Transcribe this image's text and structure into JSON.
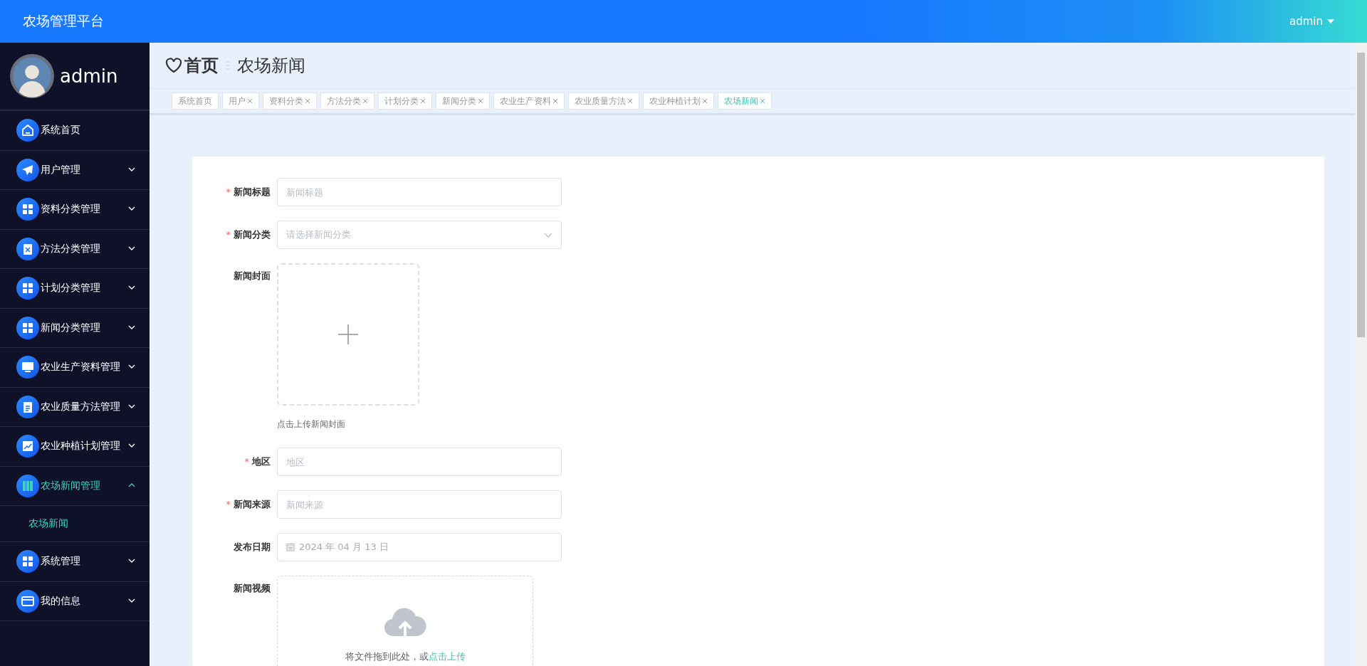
{
  "header": {
    "title": "农场管理平台",
    "user": "admin"
  },
  "profile": {
    "name": "admin"
  },
  "menu": [
    {
      "label": "系统首页",
      "selected": false
    },
    {
      "label": "用户管理",
      "selected": false,
      "expanded": false
    },
    {
      "label": "资料分类管理",
      "selected": false,
      "expanded": false
    },
    {
      "label": "方法分类管理",
      "selected": false,
      "expanded": false
    },
    {
      "label": "计划分类管理",
      "selected": false,
      "expanded": false
    },
    {
      "label": "新闻分类管理",
      "selected": false,
      "expanded": false
    },
    {
      "label": "农业生产资料管理",
      "selected": false,
      "expanded": false
    },
    {
      "label": "农业质量方法管理",
      "selected": false,
      "expanded": false
    },
    {
      "label": "农业种植计划管理",
      "selected": false,
      "expanded": false
    },
    {
      "label": "农场新闻管理",
      "selected": true,
      "expanded": true,
      "children": [
        {
          "label": "农场新闻",
          "selected": true
        }
      ]
    },
    {
      "label": "系统管理",
      "selected": false,
      "expanded": false
    },
    {
      "label": "我的信息",
      "selected": false,
      "expanded": false
    }
  ],
  "breadcrumb": {
    "home": "首页",
    "current": "农场新闻"
  },
  "tags": [
    {
      "label": "系统首页",
      "closable": false,
      "selected": false
    },
    {
      "label": "用户",
      "closable": true,
      "selected": false
    },
    {
      "label": "资料分类",
      "closable": true,
      "selected": false
    },
    {
      "label": "方法分类",
      "closable": true,
      "selected": false
    },
    {
      "label": "计划分类",
      "closable": true,
      "selected": false
    },
    {
      "label": "新闻分类",
      "closable": true,
      "selected": false
    },
    {
      "label": "农业生产资料",
      "closable": true,
      "selected": false
    },
    {
      "label": "农业质量方法",
      "closable": true,
      "selected": false
    },
    {
      "label": "农业种植计划",
      "closable": true,
      "selected": false
    },
    {
      "label": "农场新闻",
      "closable": true,
      "selected": true
    }
  ],
  "form": [
    {
      "kind": "text",
      "label": "新闻标题",
      "required_mark": "*",
      "placeholder": "新闻标题"
    },
    {
      "kind": "select",
      "label": "新闻分类",
      "required_mark": "*",
      "placeholder": "请选择新闻分类"
    },
    {
      "kind": "image-upload",
      "label": "新闻封面",
      "hint": "点击上传新闻封面"
    },
    {
      "kind": "text",
      "label": "地区",
      "required_mark": "*",
      "placeholder": "地区"
    },
    {
      "kind": "text",
      "label": "新闻来源",
      "required_mark": "*",
      "placeholder": "新闻来源"
    },
    {
      "kind": "date",
      "label": "发布日期",
      "placeholder": "2024 年 04 月 13 日"
    },
    {
      "kind": "video-upload",
      "label": "新闻视频",
      "drop_text": "将文件拖到此处，或",
      "link": "点击上传"
    }
  ]
}
